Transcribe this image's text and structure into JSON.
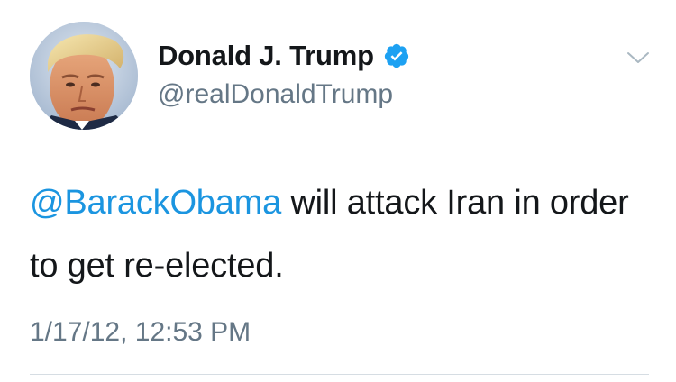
{
  "author": {
    "display_name": "Donald J. Trump",
    "handle": "@realDonaldTrump",
    "verified": true
  },
  "tweet": {
    "mention": "@BarackObama",
    "text": " will attack Iran in order to get re-elected.",
    "timestamp": "1/17/12, 12:53 PM"
  },
  "colors": {
    "link": "#1b95e0",
    "text": "#14171a",
    "secondary": "#657786",
    "verified_badge": "#1da1f2"
  },
  "icons": {
    "verified": "verified-badge-icon",
    "menu": "chevron-down-icon"
  }
}
